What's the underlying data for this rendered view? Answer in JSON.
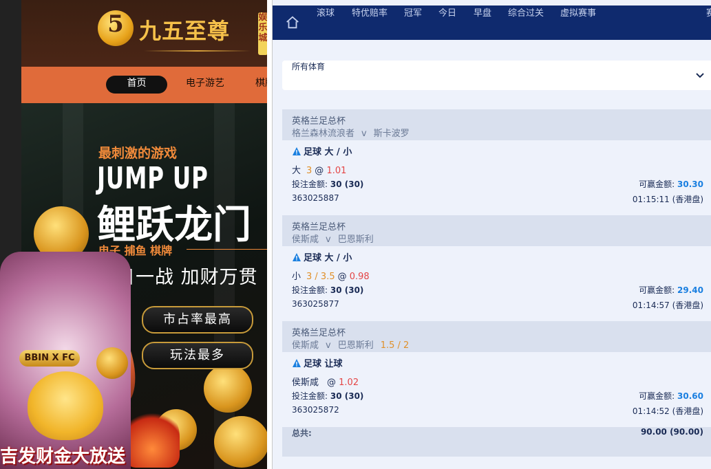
{
  "casino": {
    "logo_char": "5",
    "logo_text": "九五至尊",
    "logo_badge": "娱乐城",
    "nav": [
      "首页",
      "电子游艺",
      "棋牌"
    ],
    "banner": {
      "tagline": "最刺激的游戏",
      "title_en": "JUMP UP",
      "title_cn": "鲤跃龙门",
      "categories": "电子  捕鱼  棋牌",
      "slogan": "每日一战  加财万贯",
      "buttons": [
        "市占率最高",
        "玩法最多"
      ]
    },
    "promo": {
      "badge": "BBIN X FC",
      "bottom_text": "吉发财金大放送"
    }
  },
  "sportsbook": {
    "topnav": [
      "滚球",
      "特优赔率",
      "冠军",
      "今日",
      "早盘",
      "综合过关",
      "虚拟赛事",
      "赛"
    ],
    "sport_select": "所有体育",
    "bets": [
      {
        "league": "英格兰足总杯",
        "home": "格兰森林流浪者",
        "vs": "v",
        "away": "斯卡波罗",
        "handicap": "",
        "market": "足球 大 / 小",
        "selection": "大",
        "line": "3",
        "at": "@",
        "odds": "1.01",
        "stake_label": "投注金额:",
        "stake": "30 (30)",
        "win_label": "可赢金额:",
        "win": "30.30",
        "id": "363025887",
        "time": "01:15:11 (香港盘)"
      },
      {
        "league": "英格兰足总杯",
        "home": "侯斯咸",
        "vs": "v",
        "away": "巴恩斯利",
        "handicap": "",
        "market": "足球 大 / 小",
        "selection": "小",
        "line": "3 / 3.5",
        "at": "@",
        "odds": "0.98",
        "stake_label": "投注金额:",
        "stake": "30 (30)",
        "win_label": "可赢金额:",
        "win": "29.40",
        "id": "363025877",
        "time": "01:14:57 (香港盘)"
      },
      {
        "league": "英格兰足总杯",
        "home": "侯斯咸",
        "vs": "v",
        "away": "巴恩斯利",
        "handicap": "1.5 / 2",
        "market": "足球 让球",
        "selection": "侯斯咸",
        "line": "",
        "at": "@",
        "odds": "1.02",
        "stake_label": "投注金额:",
        "stake": "30 (30)",
        "win_label": "可赢金额:",
        "win": "30.60",
        "id": "363025872",
        "time": "01:14:52 (香港盘)"
      }
    ],
    "total_label": "总共:",
    "total_value": "90.00 (90.00)",
    "colors": {
      "topbar": "#0f2a6e",
      "odds": "#e44545",
      "line": "#e0902a",
      "win": "#1a7fe0"
    }
  }
}
